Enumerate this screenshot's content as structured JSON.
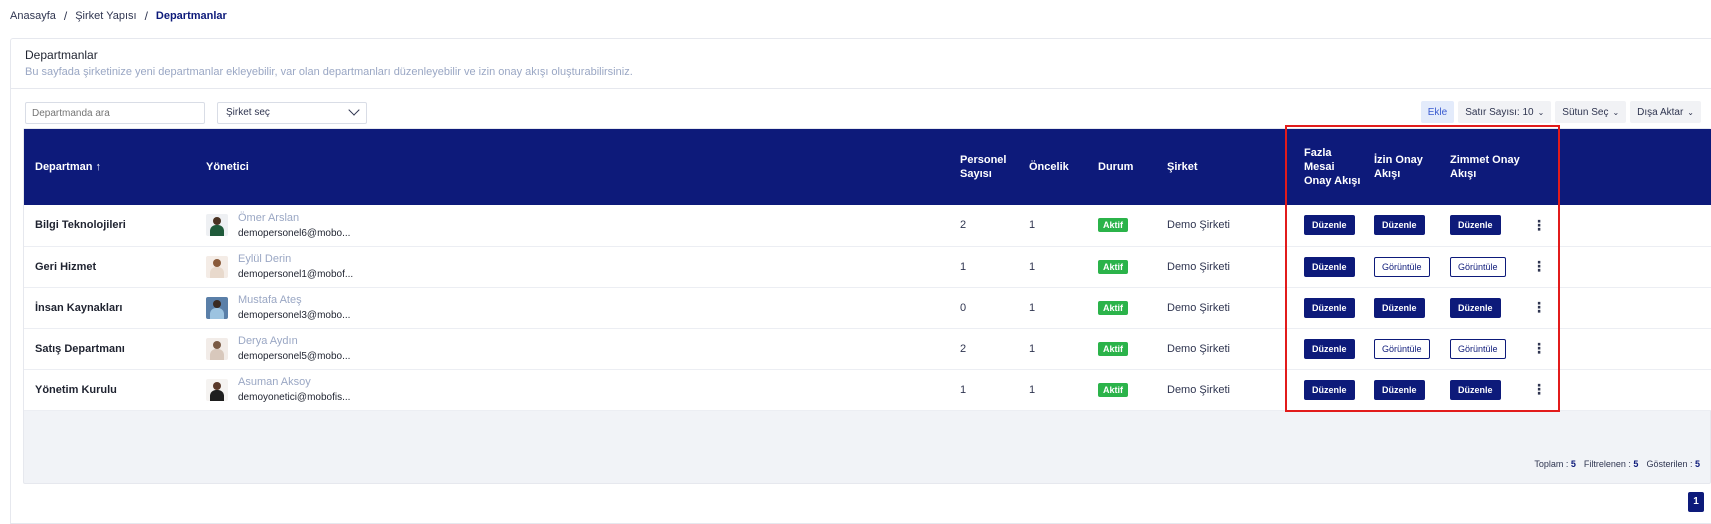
{
  "breadcrumb": {
    "home": "Anasayfa",
    "middle": "Şirket Yapısı",
    "current": "Departmanlar"
  },
  "card": {
    "title": "Departmanlar",
    "subtitle": "Bu sayfada şirketinize yeni departmanlar ekleyebilir, var olan departmanları düzenleyebilir ve izin onay akışı oluşturabilirsiniz."
  },
  "filters": {
    "search_placeholder": "Departmanda ara",
    "company_select": "Şirket seç"
  },
  "toolbar": {
    "add": "Ekle",
    "rows": "Satır Sayısı: 10",
    "columns": "Sütun Seç",
    "export": "Dışa Aktar"
  },
  "columns": {
    "department": "Departman ↑",
    "manager": "Yönetici",
    "staff_count": "Personel Sayısı",
    "priority": "Öncelik",
    "status": "Durum",
    "company": "Şirket",
    "overtime_flow": "Fazla Mesai Onay Akışı",
    "leave_flow": "İzin Onay Akışı",
    "asset_flow": "Zimmet Onay Akışı"
  },
  "rows": [
    {
      "department": "Bilgi Teknolojileri",
      "manager_name": "Ömer Arslan",
      "manager_email": "demopersonel6@mobo...",
      "staff_count": "2",
      "priority": "1",
      "status": "Aktif",
      "company": "Demo Şirketi",
      "overtime": "Düzenle",
      "leave": "Düzenle",
      "asset": "Düzenle"
    },
    {
      "department": "Geri Hizmet",
      "manager_name": "Eylül Derin",
      "manager_email": "demopersonel1@mobof...",
      "staff_count": "1",
      "priority": "1",
      "status": "Aktif",
      "company": "Demo Şirketi",
      "overtime": "Düzenle",
      "leave": "Görüntüle",
      "asset": "Görüntüle"
    },
    {
      "department": "İnsan Kaynakları",
      "manager_name": "Mustafa Ateş",
      "manager_email": "demopersonel3@mobo...",
      "staff_count": "0",
      "priority": "1",
      "status": "Aktif",
      "company": "Demo Şirketi",
      "overtime": "Düzenle",
      "leave": "Düzenle",
      "asset": "Düzenle"
    },
    {
      "department": "Satış Departmanı",
      "manager_name": "Derya Aydın",
      "manager_email": "demopersonel5@mobo...",
      "staff_count": "2",
      "priority": "1",
      "status": "Aktif",
      "company": "Demo Şirketi",
      "overtime": "Düzenle",
      "leave": "Görüntüle",
      "asset": "Görüntüle"
    },
    {
      "department": "Yönetim Kurulu",
      "manager_name": "Asuman Aksoy",
      "manager_email": "demoyonetici@mobofis...",
      "staff_count": "1",
      "priority": "1",
      "status": "Aktif",
      "company": "Demo Şirketi",
      "overtime": "Düzenle",
      "leave": "Düzenle",
      "asset": "Düzenle"
    }
  ],
  "footer": {
    "total_label": "Toplam :",
    "total": "5",
    "filtered_label": "Filtrelenen :",
    "filtered": "5",
    "shown_label": "Gösterilen :",
    "shown": "5"
  },
  "pagination": {
    "current_page": "1"
  },
  "colors": {
    "primary": "#0d1a7a",
    "active_badge": "#2bb34a",
    "highlight": "#e21b1b"
  }
}
